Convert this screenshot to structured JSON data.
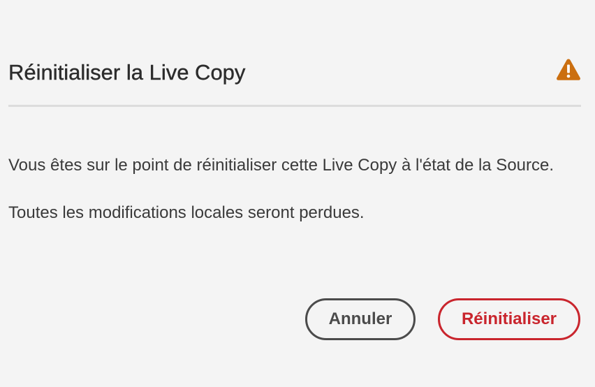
{
  "dialog": {
    "title": "Réinitialiser la Live Copy",
    "header_icon": "alert-triangle-icon",
    "body": {
      "line1": "Vous êtes sur le point de réinitialiser cette Live Copy à l'état de la Source.",
      "line2": "Toutes les modifications locales seront perdues."
    },
    "buttons": {
      "cancel_label": "Annuler",
      "confirm_label": "Réinitialiser"
    }
  },
  "colors": {
    "background": "#f4f4f4",
    "alert_icon": "#cb6f10",
    "destructive": "#c9252d",
    "secondary": "#4b4b4b",
    "divider": "#dcdcdc"
  }
}
